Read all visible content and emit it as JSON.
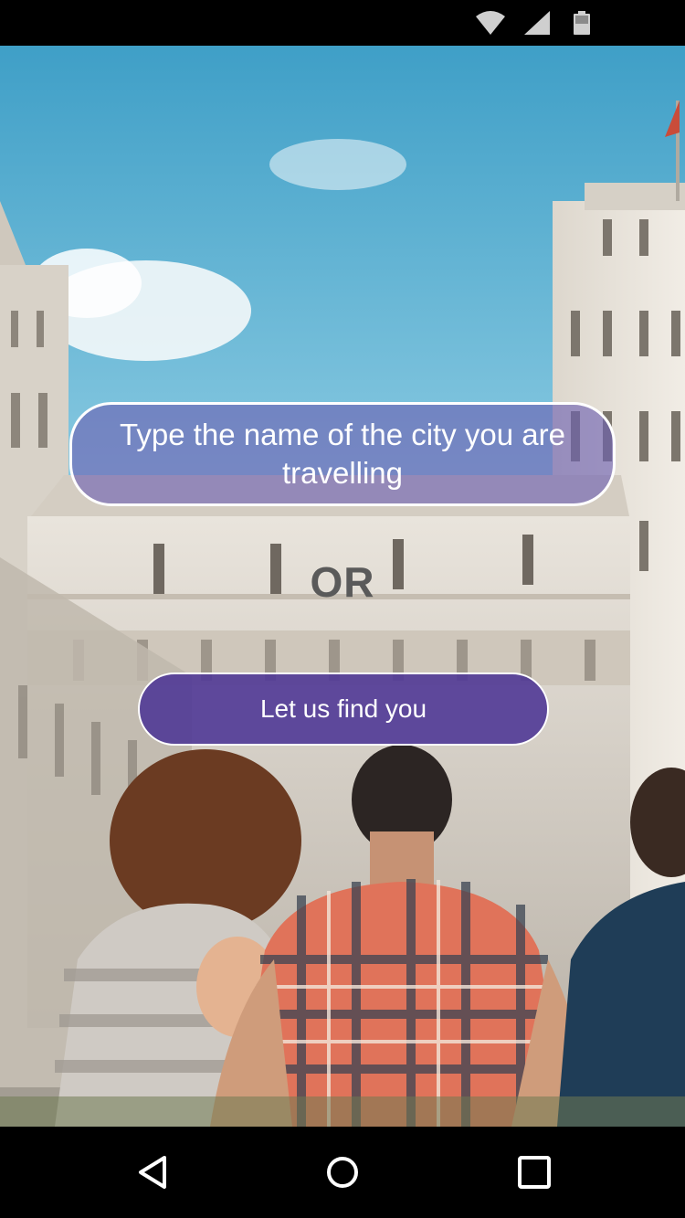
{
  "status_bar": {
    "icons": [
      "wifi-icon",
      "cellular-signal-icon",
      "battery-icon"
    ]
  },
  "main": {
    "city_field_placeholder": "Type the name of the city you are travelling",
    "separator": "OR",
    "find_button_label": "Let us find you"
  },
  "nav_bar": {
    "icons": [
      "back-icon",
      "home-icon",
      "recent-apps-icon"
    ]
  },
  "colors": {
    "field_fill": "#6c60b2",
    "button_fill": "#503896",
    "sky": "#5fb7d6",
    "separator_text": "#5a5a5a"
  }
}
